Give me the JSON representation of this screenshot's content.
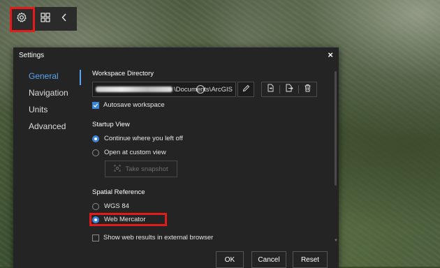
{
  "toolbar": {
    "icons": [
      "gear-icon",
      "grid-icon",
      "chevron-left-icon"
    ]
  },
  "dialog": {
    "title": "Settings",
    "close_label": "×",
    "nav": [
      {
        "label": "General",
        "active": true
      },
      {
        "label": "Navigation",
        "active": false
      },
      {
        "label": "Units",
        "active": false
      },
      {
        "label": "Advanced",
        "active": false
      }
    ],
    "general": {
      "workspace_directory_label": "Workspace Directory",
      "workspace_path_visible": "\\Documents\\ArcGIS",
      "autosave_label": "Autosave workspace",
      "autosave_checked": true,
      "startup_view_label": "Startup View",
      "startup_options": [
        {
          "label": "Continue where you left off",
          "selected": true
        },
        {
          "label": "Open at custom view",
          "selected": false
        }
      ],
      "take_snapshot_label": "Take snapshot",
      "spatial_reference_label": "Spatial Reference",
      "spatial_options": [
        {
          "label": "WGS 84",
          "selected": false
        },
        {
          "label": "Web Mercator",
          "selected": true
        }
      ],
      "external_browser_label": "Show web results in external browser",
      "external_browser_checked": false
    },
    "buttons": {
      "ok": "OK",
      "cancel": "Cancel",
      "reset": "Reset"
    }
  },
  "colors": {
    "accent": "#5aa5f2",
    "highlight": "#e41b1b",
    "dialog_bg": "#242424"
  }
}
